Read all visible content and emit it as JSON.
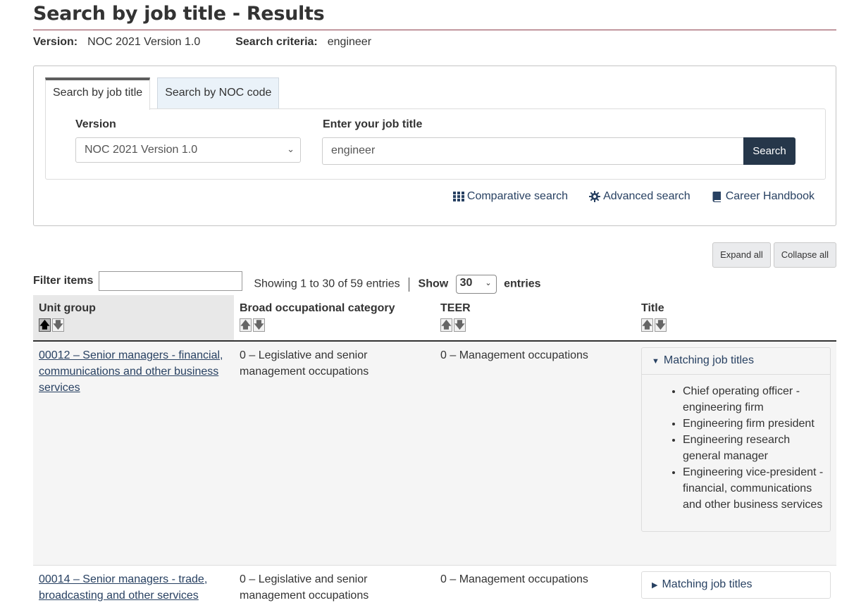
{
  "page": {
    "title": "Search by job title - Results",
    "version_label": "Version:",
    "version_value": "NOC 2021 Version 1.0",
    "criteria_label": "Search criteria:",
    "criteria_value": "engineer"
  },
  "search": {
    "tabs": [
      {
        "label": "Search by job title",
        "active": true
      },
      {
        "label": "Search by NOC code",
        "active": false
      }
    ],
    "version_label": "Version",
    "version_selected": "NOC 2021 Version 1.0",
    "job_label": "Enter your job title",
    "job_value": "engineer",
    "search_button": "Search",
    "links": [
      {
        "label": "Comparative search",
        "icon": "grid-icon"
      },
      {
        "label": "Advanced search",
        "icon": "gear-icon"
      },
      {
        "label": "Career Handbook",
        "icon": "book-icon"
      }
    ]
  },
  "actions": {
    "expand_all": "Expand all",
    "collapse_all": "Collapse all"
  },
  "filter": {
    "label": "Filter items",
    "value": "",
    "showing": "Showing 1 to 30 of 59 entries",
    "show_label": "Show",
    "entries_value": "30",
    "entries_label": "entries"
  },
  "table": {
    "columns": [
      "Unit group",
      "Broad occupational category",
      "TEER",
      "Title"
    ],
    "sorted_column": 0,
    "rows": [
      {
        "unit_group": "00012 – Senior managers - financial, communications and other business services",
        "category": "0 – Legislative and senior management occupations",
        "teer": "0 – Management occupations",
        "matching_label": "Matching job titles",
        "expanded": true,
        "titles": [
          "Chief operating officer - engineering firm",
          "Engineering firm president",
          "Engineering research general manager",
          "Engineering vice-president - financial, communications and other business services"
        ]
      },
      {
        "unit_group": "00014 – Senior managers - trade, broadcasting and other services",
        "category": "0 – Legislative and senior management occupations",
        "teer": "0 – Management occupations",
        "matching_label": "Matching job titles",
        "expanded": false,
        "titles": []
      }
    ]
  },
  "colors": {
    "link": "#284162",
    "button": "#26374a",
    "rule": "#8c3d4a"
  }
}
